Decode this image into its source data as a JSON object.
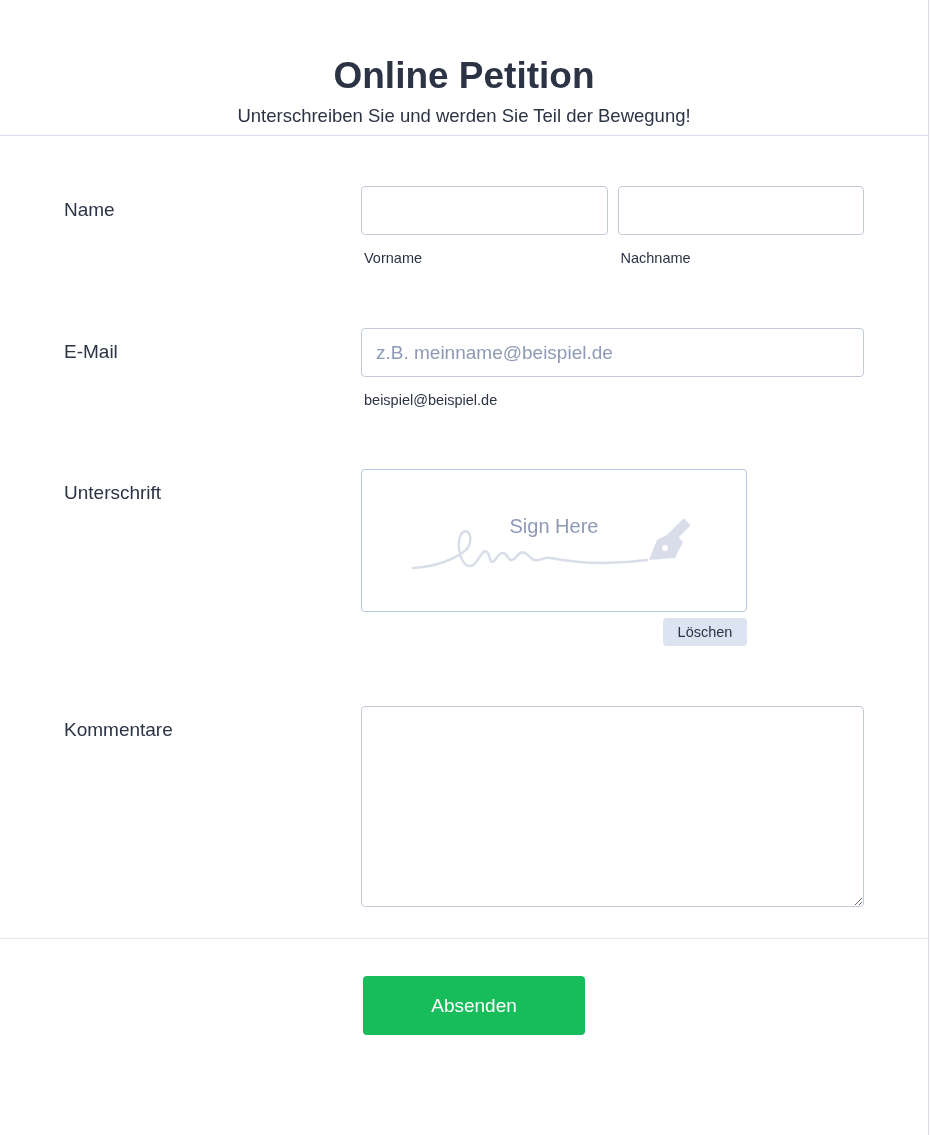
{
  "header": {
    "title": "Online Petition",
    "subtitle": "Unterschreiben Sie und werden Sie Teil der Bewegung!"
  },
  "fields": [
    {
      "kind": "name",
      "label": "Name",
      "inputs": [
        {
          "sublabel": "Vorname"
        },
        {
          "sublabel": "Nachname"
        }
      ]
    },
    {
      "kind": "email",
      "label": "E-Mail",
      "placeholder": "z.B. meinname@beispiel.de",
      "sublabel": "beispiel@beispiel.de"
    },
    {
      "kind": "signature",
      "label": "Unterschrift",
      "placeholder": "Sign Here",
      "clear_button": "Löschen"
    },
    {
      "kind": "textarea",
      "label": "Kommentare"
    }
  ],
  "submit_button": "Absenden"
}
